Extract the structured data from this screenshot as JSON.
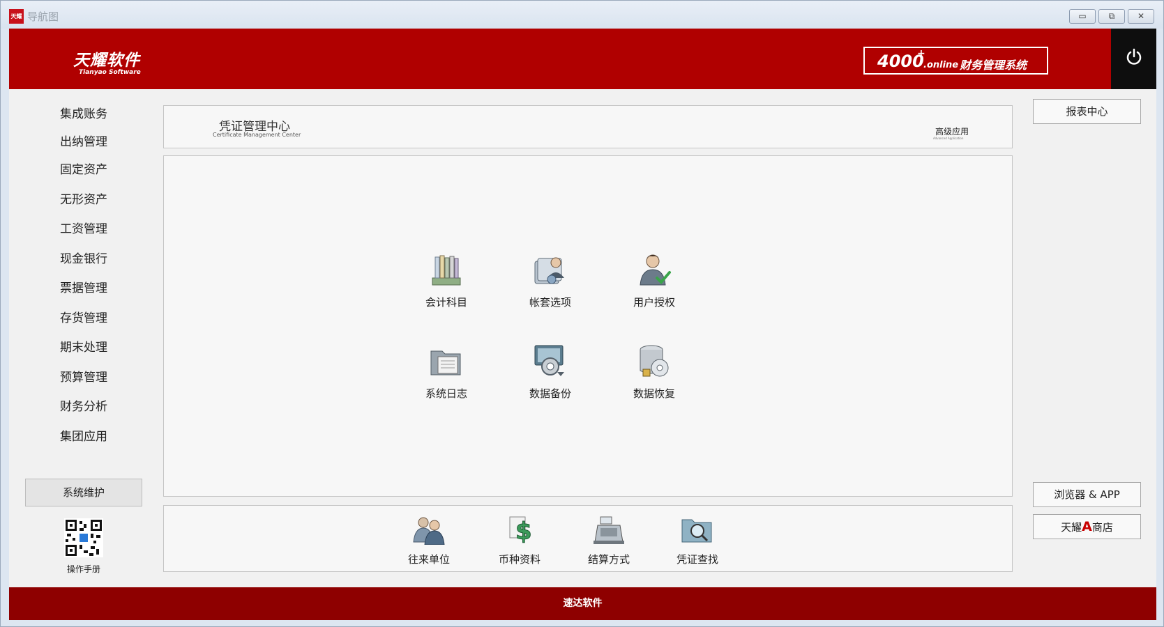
{
  "window": {
    "title": "导航图",
    "app_icon_text": "天耀",
    "minimize_glyph": "▭",
    "maximize_glyph": "⧉",
    "close_glyph": "✕"
  },
  "header": {
    "logo_cn": "天耀软件",
    "logo_en": "Tianyao Software",
    "product_number": "4000",
    "product_plus": "+",
    "product_online": ".online",
    "product_name": "财务管理系统",
    "brand_color": "#b00000"
  },
  "sidebar": {
    "items": [
      {
        "label": "集成账务"
      },
      {
        "label": "出纳管理"
      },
      {
        "label": "固定资产"
      },
      {
        "label": "无形资产"
      },
      {
        "label": "工资管理"
      },
      {
        "label": "现金银行"
      },
      {
        "label": "票据管理"
      },
      {
        "label": "存货管理"
      },
      {
        "label": "期末处理"
      },
      {
        "label": "预算管理"
      },
      {
        "label": "财务分析"
      },
      {
        "label": "集团应用"
      },
      {
        "label": "系统维护",
        "active": true
      }
    ],
    "qr_label": "操作手册"
  },
  "center": {
    "title": "凭证管理中心",
    "subtitle": "Certificate Management Center",
    "advanced_title": "高级应用",
    "advanced_subtitle": "Advanced Application",
    "tiles": [
      {
        "label": "会计科目",
        "icon": "ledger-books-icon"
      },
      {
        "label": "帐套选项",
        "icon": "account-options-icon"
      },
      {
        "label": "用户授权",
        "icon": "user-authorization-icon"
      },
      {
        "label": "系统日志",
        "icon": "system-log-icon"
      },
      {
        "label": "数据备份",
        "icon": "data-backup-icon"
      },
      {
        "label": "数据恢复",
        "icon": "data-restore-icon"
      }
    ],
    "bottom_tiles": [
      {
        "label": "往来单位",
        "icon": "partner-units-icon"
      },
      {
        "label": "币种资料",
        "icon": "currency-icon"
      },
      {
        "label": "结算方式",
        "icon": "cash-register-icon"
      },
      {
        "label": "凭证查找",
        "icon": "voucher-search-icon"
      }
    ]
  },
  "right": {
    "report_center": "报表中心",
    "browser_app": "浏览器 & APP",
    "store_prefix": "天耀",
    "store_a": "A",
    "store_suffix": "商店"
  },
  "footer": {
    "text": "速达软件"
  }
}
